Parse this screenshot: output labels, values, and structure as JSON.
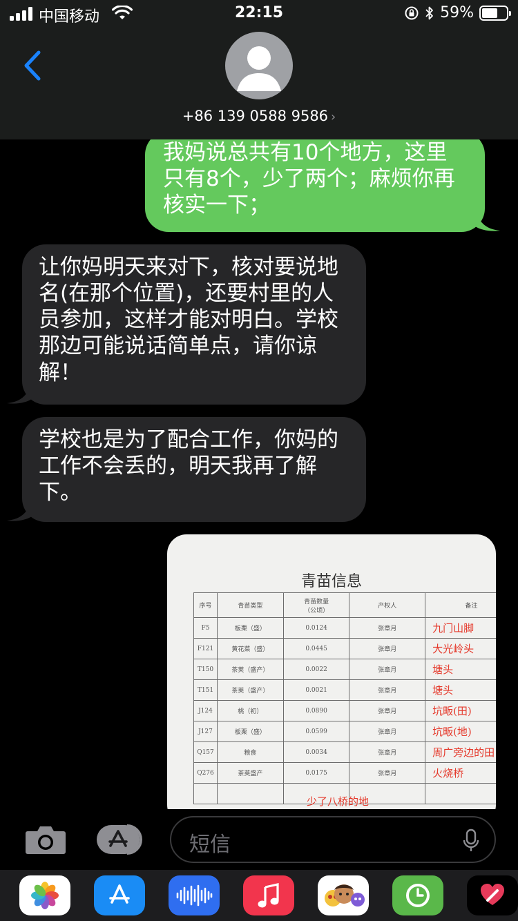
{
  "status_bar": {
    "carrier": "中国移动",
    "time": "22:15",
    "battery_percent": "59%",
    "battery_level": 0.59
  },
  "header": {
    "contact": "+86 139 0588 9586",
    "contact_chevron": "›"
  },
  "messages": [
    {
      "direction": "sent",
      "text": "我妈说总共有10个地方，这里只有8个，少了两个；麻烦你再核实一下；"
    },
    {
      "direction": "received",
      "text": "让你妈明天来对下，核对要说地名(在那个位置)，还要村里的人员参加，这样才能对明白。学校那边可能说话简单点，请你谅解！"
    },
    {
      "direction": "received",
      "text": "学校也是为了配合工作，你妈的工作不会丢的，明天我再了解下。"
    }
  ],
  "sent_photo": {
    "title": "青苗信息",
    "columns": [
      "序号",
      "青苗类型",
      "青苗数量\n（公顷）",
      "产权人",
      "备注"
    ],
    "rows": [
      [
        "F5",
        "板栗（盛）",
        "0.0124",
        "张章月",
        "九门山脚"
      ],
      [
        "F121",
        "黄花菜（盛）",
        "0.0445",
        "张章月",
        "大光岭头"
      ],
      [
        "T150",
        "茶荚（盛产）",
        "0.0022",
        "张章月",
        "塘头"
      ],
      [
        "T151",
        "茶荚（盛产）",
        "0.0021",
        "张章月",
        "塘头"
      ],
      [
        "J124",
        "桃（初）",
        "0.0890",
        "张章月",
        "坑畈(田)"
      ],
      [
        "J127",
        "板栗（盛）",
        "0.0599",
        "张章月",
        "坑畈(地)"
      ],
      [
        "Q157",
        "粮食",
        "0.0034",
        "张章月",
        "周广旁边的田"
      ],
      [
        "Q276",
        "茶荚盛产",
        "0.0175",
        "张章月",
        "火烧桥"
      ]
    ],
    "handwritten_note": "少了八桥的地"
  },
  "composer": {
    "placeholder": "短信"
  },
  "app_drawer": {
    "apps": [
      "photos-app",
      "app-store-app",
      "audio-message-app",
      "music-app",
      "memoji-app",
      "activity-app",
      "digital-touch-app"
    ]
  },
  "colors": {
    "sent_bubble": "#64c95d",
    "received_bubble": "#262628",
    "accent_blue": "#1a82fb",
    "header_bg": "#1b1d1c"
  }
}
